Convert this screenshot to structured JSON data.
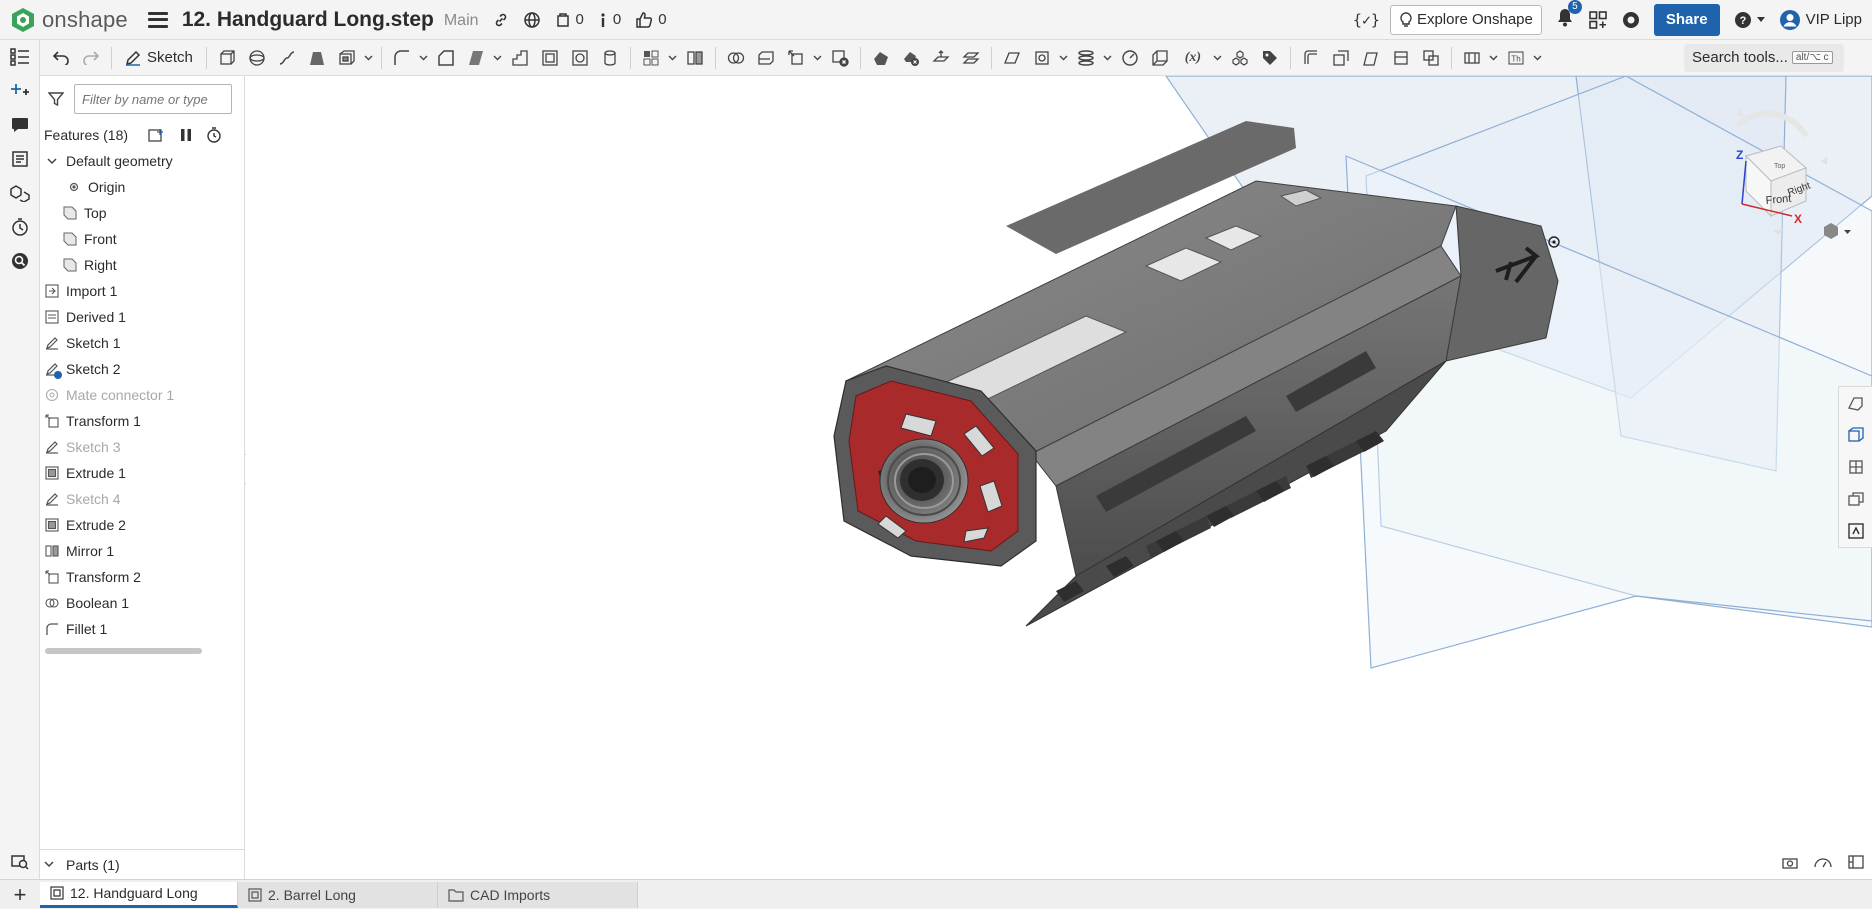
{
  "app": {
    "logo_text": "onshape",
    "document_title": "12. Handguard Long.step",
    "branch": "Main",
    "counts": {
      "versions": "0",
      "info": "0",
      "likes": "0"
    }
  },
  "topbar": {
    "explore_label": "Explore Onshape",
    "notifications_count": "5",
    "share_label": "Share",
    "user_name": "VIP Lipp"
  },
  "toolbar": {
    "sketch_label": "Sketch",
    "search_label": "Search tools...",
    "search_shortcut": "alt/⌥ c"
  },
  "panel": {
    "filter_placeholder": "Filter by name or type",
    "features_header": "Features (18)",
    "default_geometry": "Default geometry",
    "origin": "Origin",
    "planes": [
      "Top",
      "Front",
      "Right"
    ],
    "features": [
      {
        "label": "Import 1",
        "icon": "import-icon",
        "suppressed": false
      },
      {
        "label": "Derived 1",
        "icon": "derived-icon",
        "suppressed": false
      },
      {
        "label": "Sketch 1",
        "icon": "sketch-icon",
        "suppressed": false
      },
      {
        "label": "Sketch 2",
        "icon": "sketch-icon",
        "suppressed": false
      },
      {
        "label": "Mate connector 1",
        "icon": "mate-connector-icon",
        "suppressed": true
      },
      {
        "label": "Transform 1",
        "icon": "transform-icon",
        "suppressed": false
      },
      {
        "label": "Sketch 3",
        "icon": "sketch-icon",
        "suppressed": true
      },
      {
        "label": "Extrude 1",
        "icon": "extrude-icon",
        "suppressed": false
      },
      {
        "label": "Sketch 4",
        "icon": "sketch-icon",
        "suppressed": true
      },
      {
        "label": "Extrude 2",
        "icon": "extrude-icon",
        "suppressed": false
      },
      {
        "label": "Mirror 1",
        "icon": "mirror-icon",
        "suppressed": false
      },
      {
        "label": "Transform 2",
        "icon": "transform-icon",
        "suppressed": false
      },
      {
        "label": "Boolean 1",
        "icon": "boolean-icon",
        "suppressed": false
      },
      {
        "label": "Fillet 1",
        "icon": "fillet-icon",
        "suppressed": false
      }
    ],
    "parts_label": "Parts (1)"
  },
  "viewcube": {
    "front": "Front",
    "right": "Right",
    "top": "Top",
    "axis_x": "X",
    "axis_z": "Z"
  },
  "tabs": [
    {
      "label": "12. Handguard Long",
      "active": true,
      "icon": "part-studio-icon"
    },
    {
      "label": "2. Barrel Long",
      "active": false,
      "icon": "part-studio-icon"
    },
    {
      "label": "CAD Imports",
      "active": false,
      "icon": "folder-icon"
    }
  ],
  "colors": {
    "accent": "#2063ad",
    "model_body": "#7b7b7b",
    "model_face_red": "#a82a2a",
    "plane_fill": "#dfe8f3",
    "plane_edge": "#8fb0d6"
  }
}
